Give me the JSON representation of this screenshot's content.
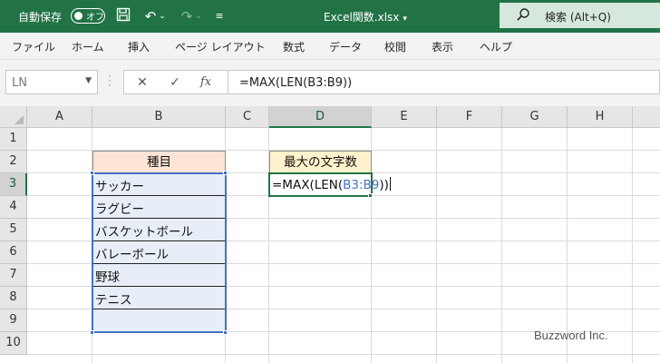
{
  "titlebar": {
    "autosave_label": "自動保存",
    "autosave_state": "オフ",
    "document_title": "Excel関数.xlsx",
    "search_placeholder": "検索 (Alt+Q)"
  },
  "ribbon": {
    "tabs": [
      "ファイル",
      "ホーム",
      "挿入",
      "ページ レイアウト",
      "数式",
      "データ",
      "校閲",
      "表示",
      "ヘルプ"
    ]
  },
  "formula_bar": {
    "name_box": "LN",
    "fx_label": "fx",
    "formula": "=MAX(LEN(B3:B9))"
  },
  "grid": {
    "columns": [
      "A",
      "B",
      "C",
      "D",
      "E",
      "F",
      "G",
      "H"
    ],
    "rows": [
      "1",
      "2",
      "3",
      "4",
      "5",
      "6",
      "7",
      "8",
      "9",
      "10"
    ],
    "selected_column": "D",
    "selected_row": "3",
    "b2_header": "種目",
    "d2_header": "最大の文字数",
    "items": [
      "サッカー",
      "ラグビー",
      "バスケットボール",
      "バレーボール",
      "野球",
      "テニス",
      ""
    ],
    "active_cell": {
      "prefix": "=MAX(LEN(",
      "range_ref": "B3:B9",
      "suffix": "))"
    }
  },
  "watermark": "Buzzword Inc.",
  "colors": {
    "excel_green": "#217346",
    "b2_fill": "#fce4d6",
    "d2_fill": "#fff2cc",
    "range_fill": "#e8eef8",
    "range_ref": "#4472c4"
  }
}
